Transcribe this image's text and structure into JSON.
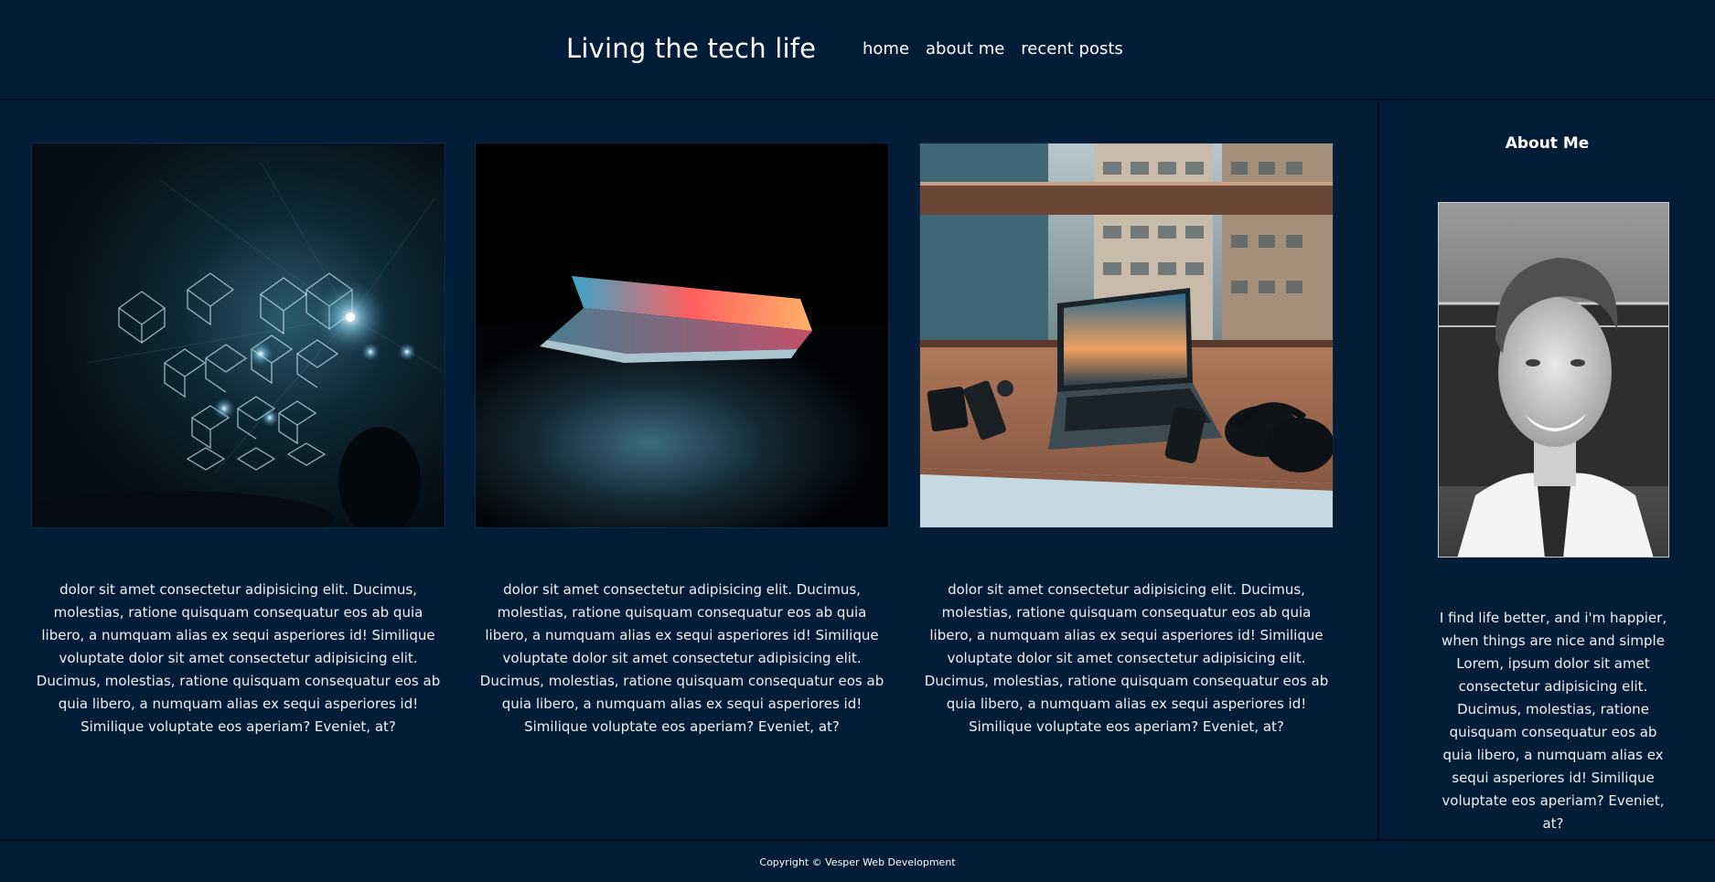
{
  "header": {
    "title": "Living the tech life",
    "nav": [
      "home",
      "about me",
      "recent posts"
    ]
  },
  "posts": [
    {
      "image": "neon-cubes-concert-photo",
      "text": "dolor sit amet consectetur adipisicing elit. Ducimus, molestias, ratione quisquam consequatur eos ab quia libero, a numquam alias ex sequi asperiores id! Similique voluptate dolor sit amet consectetur adipisicing elit. Ducimus, molestias, ratione quisquam consequatur eos ab quia libero, a numquam alias ex sequi asperiores id! Similique voluptate eos aperiam? Eveniet, at?"
    },
    {
      "image": "glowing-laptop-photo",
      "text": "dolor sit amet consectetur adipisicing elit. Ducimus, molestias, ratione quisquam consequatur eos ab quia libero, a numquam alias ex sequi asperiores id! Similique voluptate dolor sit amet consectetur adipisicing elit. Ducimus, molestias, ratione quisquam consequatur eos ab quia libero, a numquam alias ex sequi asperiores id! Similique voluptate eos aperiam? Eveniet, at?"
    },
    {
      "image": "laptop-desk-window-photo",
      "text": "dolor sit amet consectetur adipisicing elit. Ducimus, molestias, ratione quisquam consequatur eos ab quia libero, a numquam alias ex sequi asperiores id! Similique voluptate dolor sit amet consectetur adipisicing elit. Ducimus, molestias, ratione quisquam consequatur eos ab quia libero, a numquam alias ex sequi asperiores id! Similique voluptate eos aperiam? Eveniet, at?"
    }
  ],
  "sidebar": {
    "title": "About Me",
    "photo": "profile-portrait-photo",
    "text": "I find life better, and i'm happier, when things are nice and simple Lorem, ipsum dolor sit amet consectetur adipisicing elit. Ducimus, molestias, ratione quisquam consequatur eos ab quia libero, a numquam alias ex sequi asperiores id! Similique voluptate eos aperiam? Eveniet, at?"
  },
  "footer": {
    "copyright": "Copyright © Vesper Web Development"
  },
  "colors": {
    "background": "#031c38",
    "divider": "#000c1c",
    "text": "#ffffff"
  }
}
